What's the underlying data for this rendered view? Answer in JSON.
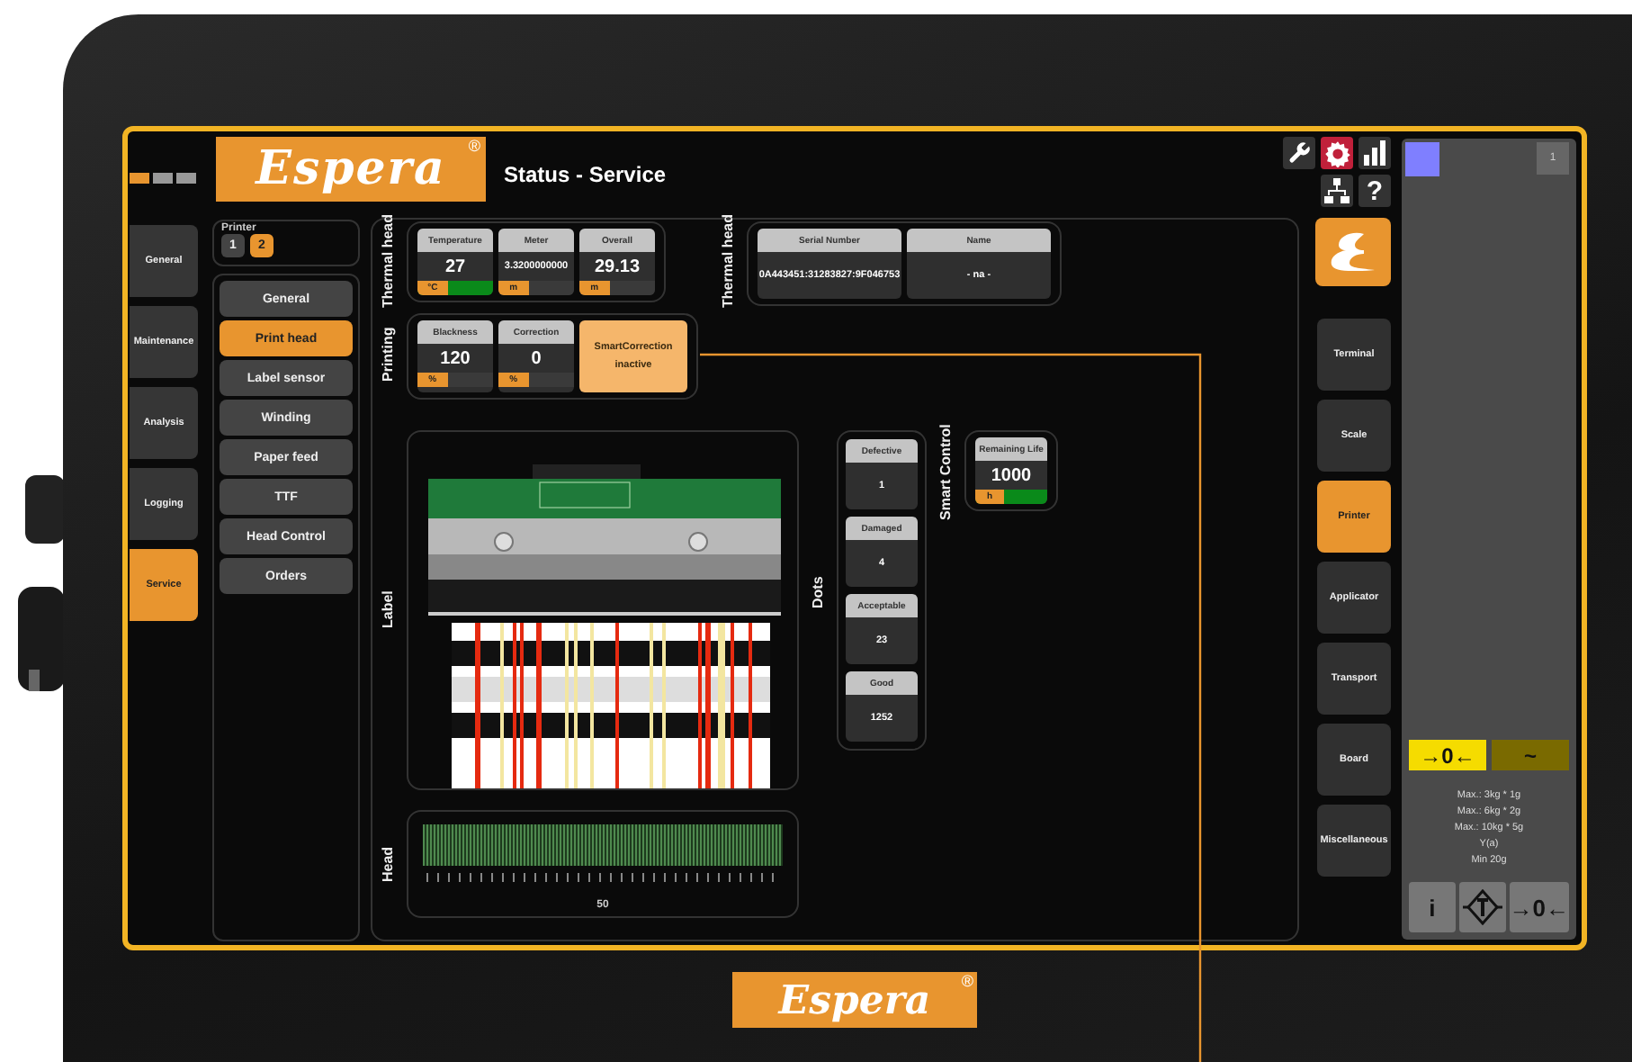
{
  "header": {
    "logo": "Espera",
    "registered": "®",
    "title": "Status - Service",
    "pages": [
      {
        "selected": true
      },
      {
        "selected": false
      },
      {
        "selected": false
      }
    ]
  },
  "nav": [
    {
      "label": "General",
      "selected": false
    },
    {
      "label": "Maintenance",
      "selected": false
    },
    {
      "label": "Analysis",
      "selected": false
    },
    {
      "label": "Logging",
      "selected": false
    },
    {
      "label": "Service",
      "selected": true
    }
  ],
  "printer": {
    "label": "Printer",
    "units": [
      {
        "label": "1",
        "selected": false
      },
      {
        "label": "2",
        "selected": true
      }
    ]
  },
  "submenu": [
    {
      "label": "General",
      "selected": false
    },
    {
      "label": "Print head",
      "selected": true
    },
    {
      "label": "Label sensor",
      "selected": false
    },
    {
      "label": "Winding",
      "selected": false
    },
    {
      "label": "Paper feed",
      "selected": false
    },
    {
      "label": "TTF",
      "selected": false
    },
    {
      "label": "Head Control",
      "selected": false
    },
    {
      "label": "Orders",
      "selected": false
    }
  ],
  "thermal_head": {
    "label": "Thermal head",
    "tiles": [
      {
        "title": "Temperature",
        "value": "27",
        "unit": "°C",
        "level": 1
      },
      {
        "title": "Meter",
        "value": "3.3200000000",
        "unit": "m"
      },
      {
        "title": "Overall",
        "value": "29.13",
        "unit": "m"
      }
    ]
  },
  "thermal_head_info": {
    "label": "Thermal head",
    "tiles": [
      {
        "title": "Serial Number",
        "value": "0A443451:31283827:9F046753"
      },
      {
        "title": "Name",
        "value": "- na -"
      }
    ]
  },
  "printing": {
    "label": "Printing",
    "tiles": [
      {
        "title": "Blackness",
        "value": "120",
        "unit": "%"
      },
      {
        "title": "Correction",
        "value": "0",
        "unit": "%"
      }
    ],
    "smart_correction": {
      "title": "SmartCorrection",
      "status": "inactive"
    }
  },
  "label_view": {
    "label": "Label"
  },
  "dots": {
    "label": "Dots",
    "tiles": [
      {
        "title": "Defective",
        "value": "1"
      },
      {
        "title": "Damaged",
        "value": "4"
      },
      {
        "title": "Acceptable",
        "value": "23"
      },
      {
        "title": "Good",
        "value": "1252"
      }
    ]
  },
  "smart_control": {
    "label": "Smart Control",
    "tiles": [
      {
        "title": "Remaining Life",
        "value": "1000",
        "unit": "h",
        "level": 1
      }
    ]
  },
  "head": {
    "label": "Head",
    "value": "50"
  },
  "toolbar": {
    "help": "?"
  },
  "modules": [
    {
      "label": "Terminal",
      "selected": false
    },
    {
      "label": "Scale",
      "selected": false
    },
    {
      "label": "Printer",
      "selected": true
    },
    {
      "label": "Applicator",
      "selected": false
    },
    {
      "label": "Transport",
      "selected": false
    },
    {
      "label": "Board",
      "selected": false
    },
    {
      "label": "Miscellaneous",
      "selected": false
    }
  ],
  "scale": {
    "page": "1",
    "indicators": [
      {
        "symbol": "→0←",
        "on": true
      },
      {
        "symbol": "~",
        "on": false
      }
    ],
    "info": [
      "Max.: 3kg * 1g",
      "Max.: 6kg * 2g",
      "Max.: 10kg * 5g",
      "Y(a)",
      "Min 20g"
    ],
    "buttons": [
      {
        "kind": "text",
        "label": "i"
      },
      {
        "kind": "tare"
      },
      {
        "kind": "text",
        "label": "→0←"
      }
    ]
  },
  "device": {
    "logo": "Espera",
    "registered": "®"
  }
}
